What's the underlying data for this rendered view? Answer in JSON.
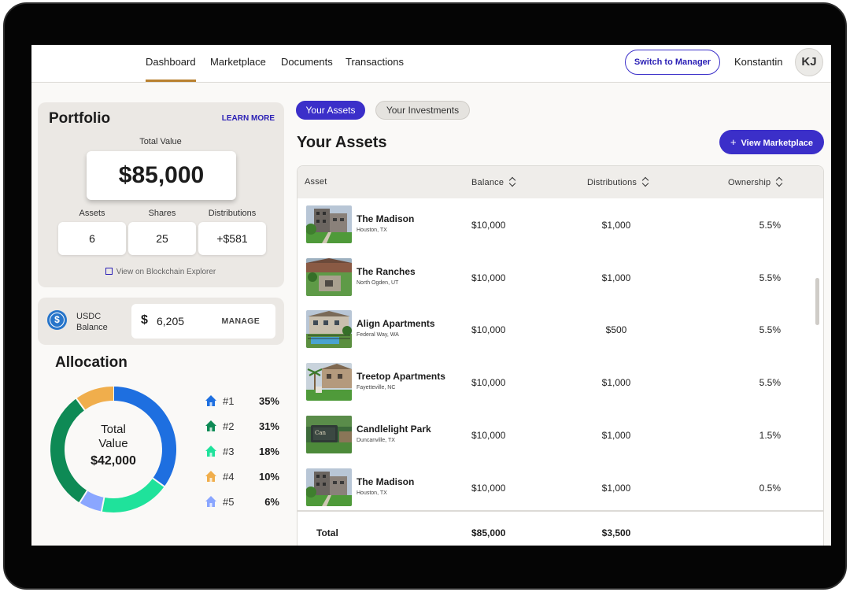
{
  "nav": {
    "tabs": [
      {
        "label": "Dashboard",
        "active": true
      },
      {
        "label": "Marketplace",
        "active": false
      },
      {
        "label": "Documents",
        "active": false
      },
      {
        "label": "Transactions",
        "active": false
      }
    ],
    "switch_label": "Switch to Manager",
    "username": "Konstantin",
    "avatar_initials": "KJ"
  },
  "portfolio": {
    "title": "Portfolio",
    "learn_more": "LEARN MORE",
    "total_value_label": "Total Value",
    "total_value": "$85,000",
    "stats": [
      {
        "label": "Assets",
        "value": "6"
      },
      {
        "label": "Shares",
        "value": "25"
      },
      {
        "label": "Distributions",
        "value": "+$581"
      }
    ],
    "explorer_link": "View on Blockchain Explorer"
  },
  "usdc": {
    "label_line1": "USDC",
    "label_line2": "Balance",
    "currency_symbol": "$",
    "amount": "6,205",
    "manage_label": "MANAGE"
  },
  "allocation": {
    "title": "Allocation",
    "center_line1": "Total",
    "center_line2": "Value",
    "center_value": "$42,000",
    "items": [
      {
        "rank": "#1",
        "pct": "35%",
        "share": 35,
        "color": "#1e6fe0"
      },
      {
        "rank": "#2",
        "pct": "31%",
        "share": 31,
        "color": "#0e8a55"
      },
      {
        "rank": "#3",
        "pct": "18%",
        "share": 18,
        "color": "#1fe29b"
      },
      {
        "rank": "#4",
        "pct": "10%",
        "share": 10,
        "color": "#f0ae4c"
      },
      {
        "rank": "#5",
        "pct": "6%",
        "share": 6,
        "color": "#8aa6ff"
      }
    ]
  },
  "assets_view": {
    "tabs": [
      "Your Assets",
      "Your Investments"
    ],
    "title": "Your Assets",
    "view_marketplace_label": "View Marketplace",
    "columns": [
      "Asset",
      "Balance",
      "Distributions",
      "Ownership"
    ],
    "rows": [
      {
        "name": "The Madison",
        "location": "Houston, TX",
        "balance": "$10,000",
        "distributions": "$1,000",
        "ownership": "5.5%",
        "thumb": "tower"
      },
      {
        "name": "The Ranches",
        "location": "North Ogden, UT",
        "balance": "$10,000",
        "distributions": "$1,000",
        "ownership": "5.5%",
        "thumb": "court"
      },
      {
        "name": "Align Apartments",
        "location": "Federal Way, WA",
        "balance": "$10,000",
        "distributions": "$500",
        "ownership": "5.5%",
        "thumb": "pool"
      },
      {
        "name": "Treetop Apartments",
        "location": "Fayetteville, NC",
        "balance": "$10,000",
        "distributions": "$1,000",
        "ownership": "5.5%",
        "thumb": "palm"
      },
      {
        "name": "Candlelight Park",
        "location": "Duncanville, TX",
        "balance": "$10,000",
        "distributions": "$1,000",
        "ownership": "1.5%",
        "thumb": "sign"
      },
      {
        "name": "The Madison",
        "location": "Houston, TX",
        "balance": "$10,000",
        "distributions": "$1,000",
        "ownership": "0.5%",
        "thumb": "tower"
      }
    ],
    "total_label": "Total",
    "total_balance": "$85,000",
    "total_distributions": "$3,500"
  }
}
